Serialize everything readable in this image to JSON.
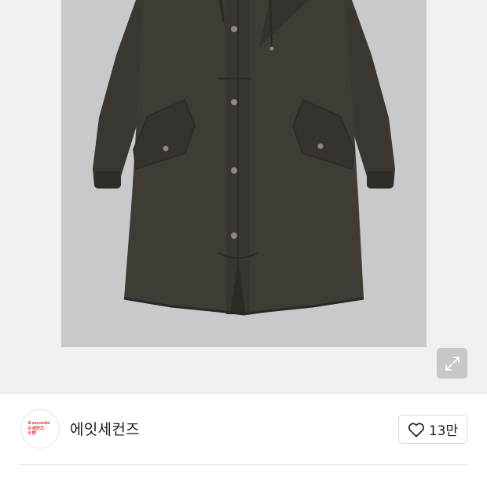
{
  "product_image": {
    "alt_icon": "hooded-parka-coat-photo"
  },
  "expand_button": {
    "icon": "expand-diagonal-arrows-icon"
  },
  "brand": {
    "logo_lines": [
      "8 seconds",
      "8 세컨즈",
      "8 秒"
    ],
    "name": "에잇세컨즈"
  },
  "like": {
    "icon": "heart-outline-icon",
    "count": "13만"
  },
  "colors": {
    "brand_red": "#e0262a",
    "background_gray": "#f0f0f1",
    "coat": "#3f3b35"
  }
}
